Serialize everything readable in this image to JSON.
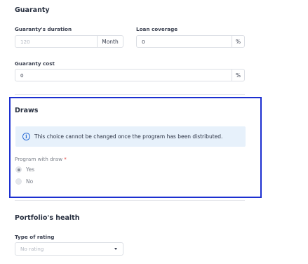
{
  "guaranty": {
    "title": "Guaranty",
    "duration": {
      "label": "Guaranty's duration",
      "placeholder": "120",
      "unit": "Month"
    },
    "coverage": {
      "label": "Loan coverage",
      "value": "0",
      "unit": "%"
    },
    "cost": {
      "label": "Guaranty cost",
      "value": "0",
      "unit": "%"
    }
  },
  "draws": {
    "title": "Draws",
    "info": {
      "icon": "info-icon",
      "text": "This choice cannot be changed once the program has been distributed."
    },
    "program_with_draw": {
      "label": "Program with draw",
      "required_mark": "*",
      "options": [
        {
          "label": "Yes",
          "selected": true
        },
        {
          "label": "No",
          "selected": false
        }
      ]
    }
  },
  "portfolio_health": {
    "title": "Portfolio's health",
    "type_of_rating": {
      "label": "Type of rating",
      "placeholder": "No rating"
    }
  },
  "colors": {
    "highlight_border": "#1c2fd0",
    "info_bg": "#e7f1fb",
    "info_accent": "#2f6fd6"
  }
}
